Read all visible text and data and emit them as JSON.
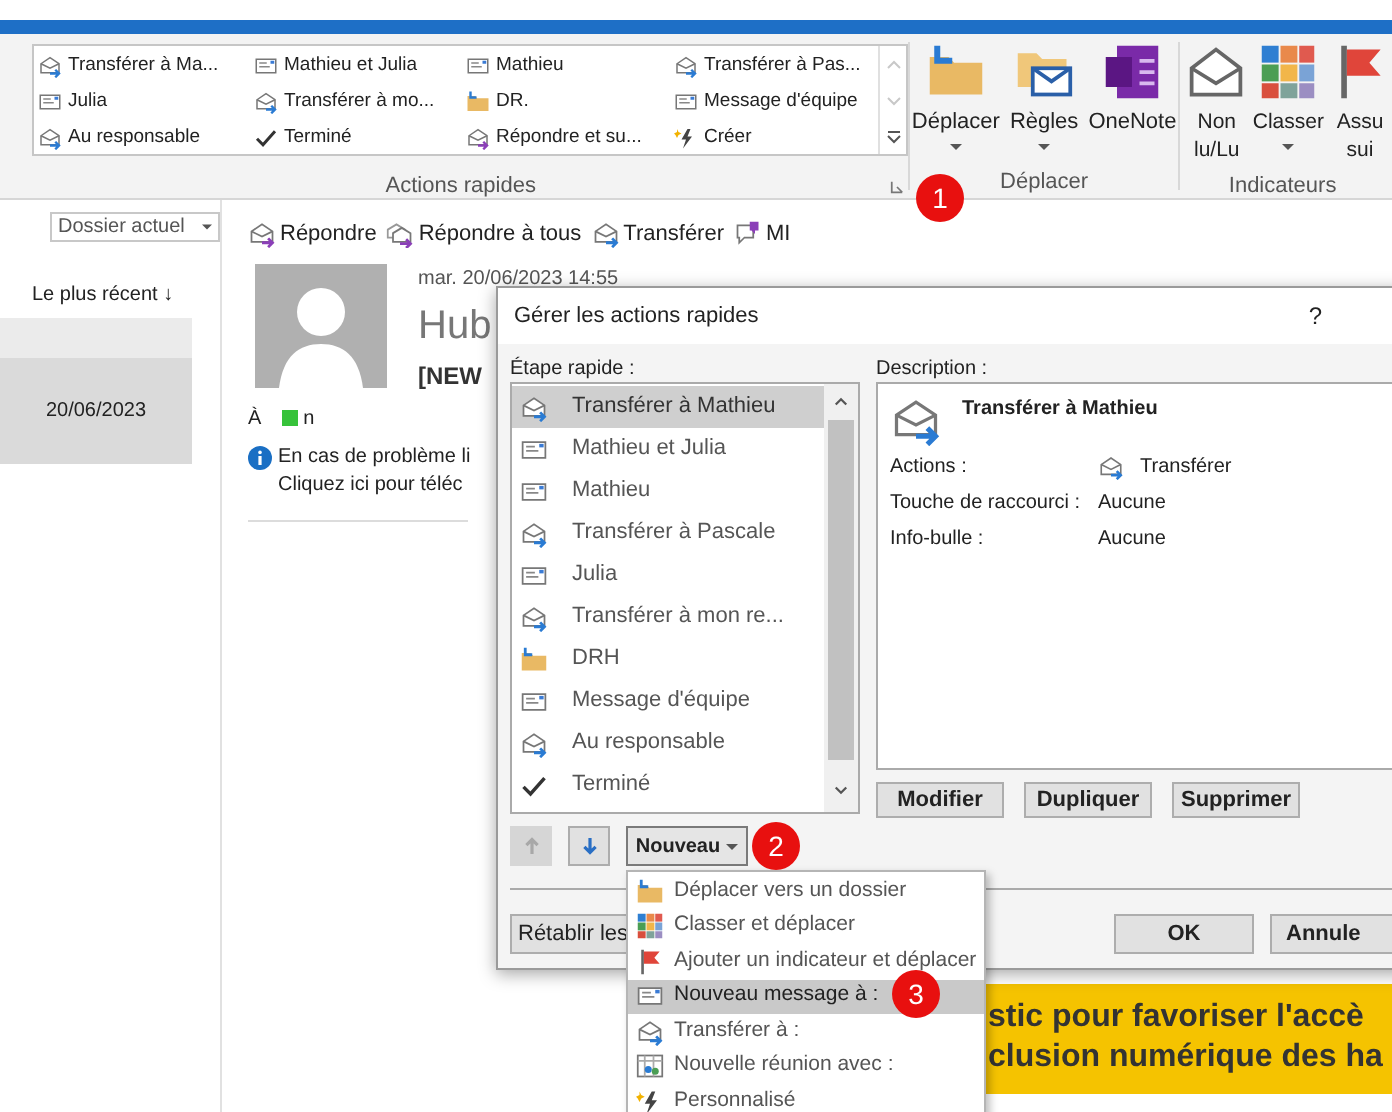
{
  "ribbon": {
    "quick_steps": {
      "label": "Actions rapides",
      "items": [
        {
          "label": "Transférer à Ma...",
          "kind": "forward"
        },
        {
          "label": "Mathieu et Julia",
          "kind": "message"
        },
        {
          "label": "Mathieu",
          "kind": "message"
        },
        {
          "label": "Transférer à Pas...",
          "kind": "forward"
        },
        {
          "label": "Julia",
          "kind": "message"
        },
        {
          "label": "Transférer à mo...",
          "kind": "forward"
        },
        {
          "label": "DR.",
          "kind": "move"
        },
        {
          "label": "Message d'équipe",
          "kind": "message"
        },
        {
          "label": "Au responsable",
          "kind": "forward"
        },
        {
          "label": "Terminé",
          "kind": "done"
        },
        {
          "label": "Répondre et su...",
          "kind": "reply"
        },
        {
          "label": "Créer",
          "kind": "create"
        }
      ]
    },
    "move_group": {
      "label": "Déplacer",
      "buttons": [
        {
          "lines": [
            "Déplacer"
          ],
          "kind": "move",
          "dropdown": true
        },
        {
          "lines": [
            "Règles"
          ],
          "kind": "rules",
          "dropdown": true
        },
        {
          "lines": [
            "OneNote"
          ],
          "kind": "onenote",
          "dropdown": false
        }
      ]
    },
    "tags_group": {
      "label": "Indicateurs",
      "buttons": [
        {
          "lines": [
            "Non",
            "lu/Lu"
          ],
          "kind": "unread",
          "dropdown": false
        },
        {
          "lines": [
            "Classer"
          ],
          "kind": "grid",
          "dropdown": true
        },
        {
          "lines": [
            "Assu",
            "sui"
          ],
          "kind": "flag",
          "dropdown": false
        }
      ]
    }
  },
  "folder_pane": {
    "scope": "Dossier actuel",
    "sort": "Le plus récent ↓",
    "messages": [
      {
        "date": "20/06/2023",
        "selected": true
      }
    ]
  },
  "reading_pane": {
    "actions": [
      {
        "label": "Répondre",
        "kind": "reply"
      },
      {
        "label": "Répondre à tous",
        "kind": "reply-all"
      },
      {
        "label": "Transférer",
        "kind": "forward"
      },
      {
        "label": "MI",
        "kind": "chat"
      }
    ],
    "date": "mar. 20/06/2023 14:55",
    "sender": "Hub",
    "subject": "[NEW",
    "to_label": "À",
    "recipient": "n",
    "info": [
      "En cas de problème li",
      "Cliquez ici pour téléc"
    ],
    "banner": [
      "stic pour favoriser l'accè",
      "clusion numérique des ha"
    ]
  },
  "dialog": {
    "title": "Gérer les actions rapides",
    "help": "?",
    "list_label": "Étape rapide :",
    "steps": [
      {
        "label": "Transférer à Mathieu",
        "kind": "forward",
        "selected": true
      },
      {
        "label": "Mathieu et Julia",
        "kind": "message",
        "selected": false
      },
      {
        "label": "Mathieu",
        "kind": "message",
        "selected": false
      },
      {
        "label": "Transférer à Pascale",
        "kind": "forward",
        "selected": false
      },
      {
        "label": "Julia",
        "kind": "message",
        "selected": false
      },
      {
        "label": "Transférer à mon re...",
        "kind": "forward",
        "selected": false
      },
      {
        "label": "DRH",
        "kind": "move",
        "selected": false
      },
      {
        "label": "Message d'équipe",
        "kind": "message",
        "selected": false
      },
      {
        "label": "Au responsable",
        "kind": "forward",
        "selected": false
      },
      {
        "label": "Terminé",
        "kind": "done",
        "selected": false
      }
    ],
    "description_label": "Description :",
    "description": {
      "title": "Transférer à Mathieu",
      "kind": "forward",
      "rows": [
        {
          "label": "Actions :",
          "value": "Transférer",
          "kind": "forward"
        },
        {
          "label": "Touche de raccourci :",
          "value": "Aucune"
        },
        {
          "label": "Info-bulle :",
          "value": "Aucune"
        }
      ]
    },
    "edit_buttons": [
      "Modifier",
      "Dupliquer",
      "Supprimer"
    ],
    "move_up": {
      "disabled": true
    },
    "move_down": {
      "disabled": false
    },
    "new_button": "Nouveau",
    "footer_buttons": [
      "Rétablir les",
      "OK",
      "Annule"
    ]
  },
  "menu": {
    "items": [
      {
        "label": "Déplacer vers un dossier",
        "kind": "move",
        "selected": false
      },
      {
        "label": "Classer et déplacer",
        "kind": "grid",
        "selected": false
      },
      {
        "label": "Ajouter un indicateur et déplacer",
        "kind": "flag",
        "selected": false
      },
      {
        "label": "Nouveau message à :",
        "kind": "message",
        "selected": true
      },
      {
        "label": "Transférer à :",
        "kind": "forward",
        "selected": false
      },
      {
        "label": "Nouvelle réunion avec :",
        "kind": "meeting",
        "selected": false
      },
      {
        "label": "Personnalisé",
        "kind": "create",
        "selected": false
      }
    ]
  },
  "callouts": [
    "1",
    "2",
    "3"
  ]
}
